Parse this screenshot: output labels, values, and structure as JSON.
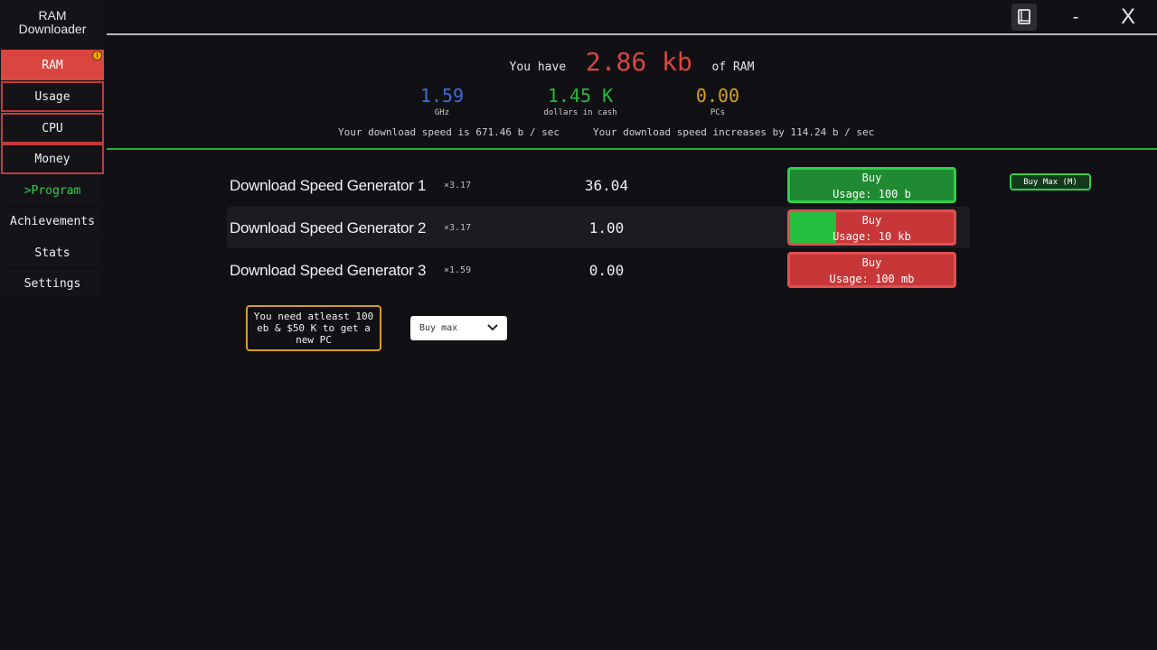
{
  "app": {
    "title_line1": "RAM",
    "title_line2": "Downloader"
  },
  "sidebar": {
    "items": [
      {
        "label": "RAM"
      },
      {
        "label": "Usage"
      },
      {
        "label": "CPU"
      },
      {
        "label": "Money"
      },
      {
        "label": ">Program"
      },
      {
        "label": "Achievements"
      },
      {
        "label": "Stats"
      },
      {
        "label": "Settings"
      }
    ]
  },
  "window": {
    "minimize_label": "-",
    "close_label": "X"
  },
  "summary": {
    "prefix": "You have",
    "ram_value": "2.86 kb",
    "suffix": "of RAM",
    "ghz_value": "1.59",
    "ghz_label": "GHz",
    "cash_value": "1.45 K",
    "cash_label": "dollars in cash",
    "pcs_value": "0.00",
    "pcs_label": "PCs",
    "speed_text": "Your download speed is 671.46 b / sec",
    "increase_text": "Your download speed increases by 114.24 b / sec"
  },
  "generators": [
    {
      "name": "Download Speed Generator 1",
      "multiplier": "×3.17",
      "count": "36.04",
      "buy_label": "Buy",
      "cost": "Usage: 100 b",
      "affordable": true,
      "progress": 1.0
    },
    {
      "name": "Download Speed Generator 2",
      "multiplier": "×3.17",
      "count": "1.00",
      "buy_label": "Buy",
      "cost": "Usage: 10 kb",
      "affordable": false,
      "progress": 0.28
    },
    {
      "name": "Download Speed Generator 3",
      "multiplier": "×1.59",
      "count": "0.00",
      "buy_label": "Buy",
      "cost": "Usage: 100 mb",
      "affordable": false,
      "progress": 0.0
    }
  ],
  "buy_max_m": "Buy Max (M)",
  "new_pc": {
    "text": "You need atleast 100 eb & $50 K to get a new PC"
  },
  "buy_mode": {
    "selected": "Buy max"
  },
  "colors": {
    "accent_red": "#d9463f",
    "accent_green": "#2fcf4b",
    "cash_green": "#25b83d",
    "ghz_blue": "#3c6de0",
    "pc_gold": "#d69e1f"
  }
}
